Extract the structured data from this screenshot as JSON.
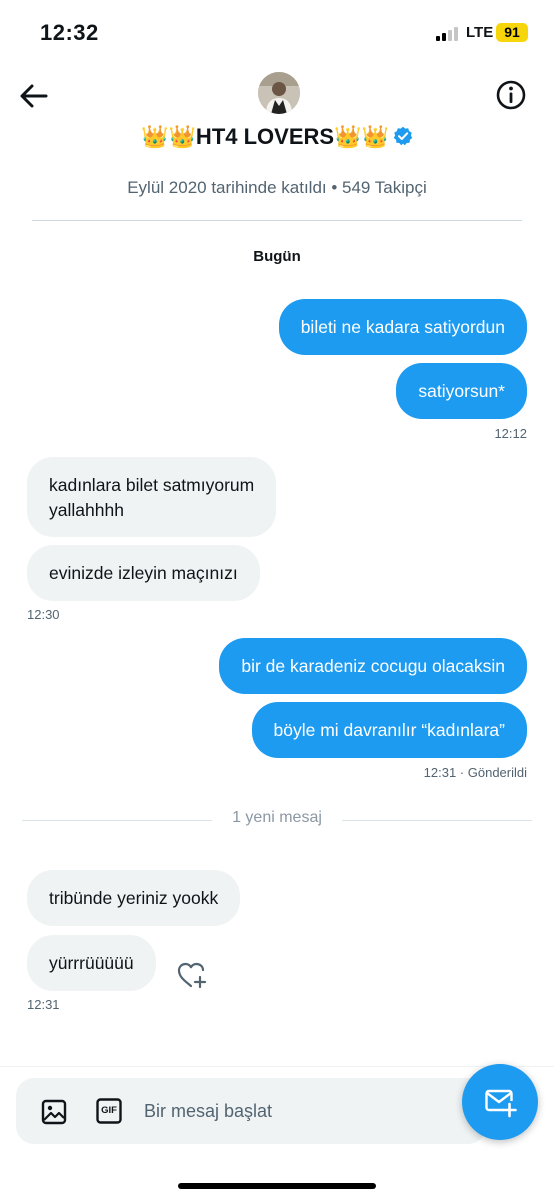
{
  "status_bar": {
    "time": "12:32",
    "network": "LTE",
    "battery": "91"
  },
  "header": {
    "title": "👑👑HT4 LOVERS👑👑",
    "subtitle": "Eylül 2020 tarihinde katıldı • 549 Takipçi"
  },
  "date_label": "Bugün",
  "messages": [
    {
      "text": "bileti ne kadara satiyordun",
      "direction": "sent"
    },
    {
      "text": "satiyorsun*",
      "direction": "sent",
      "time": "12:12"
    },
    {
      "text": "kadınlara bilet satmıyorum",
      "text2": "yallahhhh",
      "direction": "received"
    },
    {
      "text": "evinizde izleyin maçınızı",
      "direction": "received",
      "time": "12:30"
    },
    {
      "text": "bir de karadeniz cocugu olacaksin",
      "direction": "sent"
    },
    {
      "text": "böyle mi davranılır “kadınlara”",
      "direction": "sent",
      "time": "12:31 · Gönderildi"
    },
    {
      "text": "tribünde yeriniz yookk",
      "direction": "received"
    },
    {
      "text": "yürrrüüüüü",
      "direction": "received",
      "time": "12:31"
    }
  ],
  "new_messages_divider": "1 yeni mesaj",
  "composer": {
    "placeholder": "Bir mesaj başlat",
    "gif_label": "GIF"
  },
  "icons": {
    "back": "back-arrow-icon",
    "info": "info-icon",
    "verified": "verified-badge-icon",
    "image": "image-icon",
    "gif": "gif-icon",
    "react": "heart-plus-icon",
    "new_message": "new-message-icon"
  },
  "colors": {
    "accent": "#1d9bf0",
    "received_bubble": "#eff3f4",
    "muted_text": "#536471",
    "battery": "#f6d60b"
  }
}
